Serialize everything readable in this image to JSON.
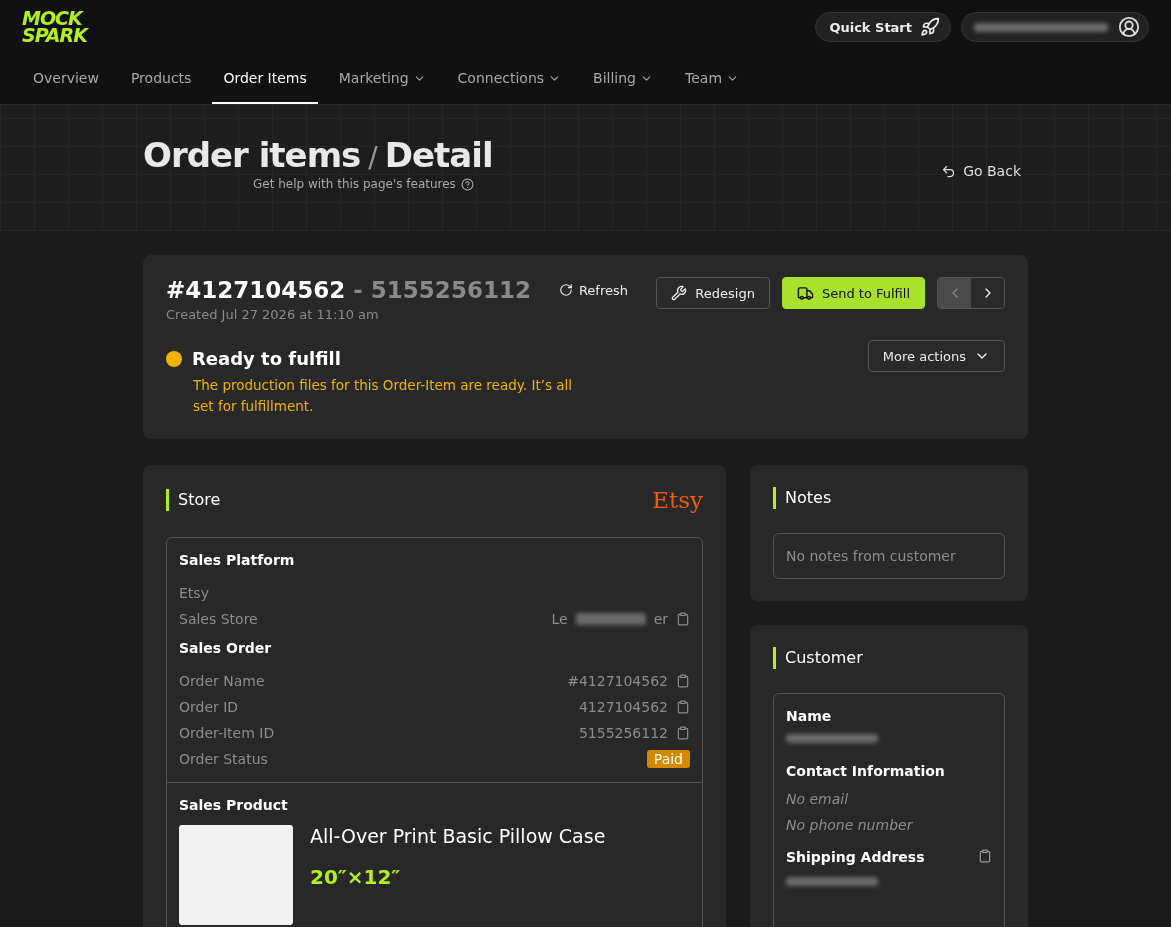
{
  "logo": {
    "line1": "MOCK",
    "line2": "SPARK"
  },
  "header": {
    "quick_start": "Quick Start"
  },
  "nav": [
    {
      "label": "Overview",
      "selected": false,
      "dropdown": false
    },
    {
      "label": "Products",
      "selected": false,
      "dropdown": false
    },
    {
      "label": "Order Items",
      "selected": true,
      "dropdown": false
    },
    {
      "label": "Marketing",
      "selected": false,
      "dropdown": true
    },
    {
      "label": "Connections",
      "selected": false,
      "dropdown": true
    },
    {
      "label": "Billing",
      "selected": false,
      "dropdown": true
    },
    {
      "label": "Team",
      "selected": false,
      "dropdown": true
    }
  ],
  "hero": {
    "title": "Order items",
    "separator": "/",
    "subtitle": "Detail",
    "help": "Get help with this page's features",
    "go_back": "Go Back"
  },
  "order": {
    "number": "#4127104562",
    "dash": "-",
    "item_id": "5155256112",
    "refresh": "Refresh",
    "created": "Created Jul 27 2026 at 11:10 am",
    "redesign": "Redesign",
    "send": "Send to Fulfill",
    "more_actions": "More actions",
    "prev_disabled": true,
    "status": {
      "title": "Ready to fulfill",
      "color": "#f0b400",
      "description": "The production files for this Order-Item are ready. It’s all set for fulfillment."
    }
  },
  "store": {
    "title": "Store",
    "brand": "Etsy",
    "platform_heading": "Sales Platform",
    "platform": "Etsy",
    "store_label": "Sales Store",
    "store_value_start": "Le",
    "store_value_end": "er",
    "order_heading": "Sales Order",
    "rows": [
      {
        "label": "Order Name",
        "value": "#4127104562"
      },
      {
        "label": "Order ID",
        "value": "4127104562"
      },
      {
        "label": "Order-Item ID",
        "value": "5155256112"
      }
    ],
    "status_label": "Order Status",
    "status_value": "Paid",
    "product_heading": "Sales Product",
    "product_name": "All-Over Print Basic Pillow Case",
    "product_size": "20″×12″"
  },
  "notes": {
    "title": "Notes",
    "text": "No notes from customer"
  },
  "customer": {
    "title": "Customer",
    "name_heading": "Name",
    "contact_heading": "Contact Information",
    "email": "No email",
    "phone": "No phone number",
    "address_heading": "Shipping Address"
  }
}
